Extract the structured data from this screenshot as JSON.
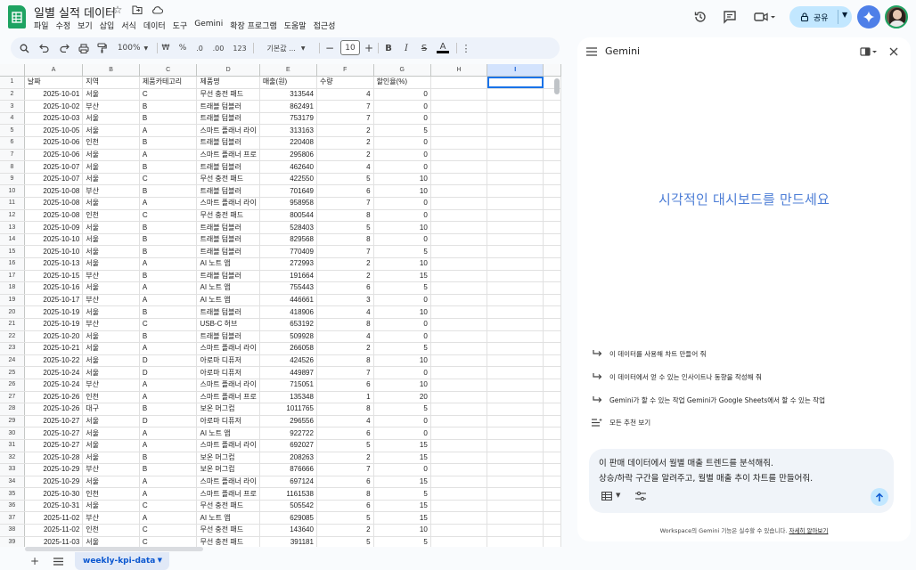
{
  "doc": {
    "title": "일별 실적 데이터"
  },
  "menu": [
    "파일",
    "수정",
    "보기",
    "삽입",
    "서식",
    "데이터",
    "도구",
    "Gemini",
    "확장 프로그램",
    "도움말",
    "접근성"
  ],
  "share": {
    "label": "공유"
  },
  "toolbar": {
    "zoom": "100%",
    "currency": "₩",
    "percent": "%",
    "dec_dec": ".0",
    "dec_inc": ".00",
    "num_fmt": "123",
    "font": "기본값 ...",
    "font_size": "10",
    "bold": "B",
    "italic": "I",
    "strike": "S",
    "text_color": "A"
  },
  "sheet": {
    "columns": [
      "A",
      "B",
      "C",
      "D",
      "E",
      "F",
      "G",
      "H",
      "I"
    ],
    "selected_column": "I",
    "headers": [
      "날짜",
      "지역",
      "제품카테고리",
      "제품명",
      "매출(원)",
      "수량",
      "할인율(%)"
    ],
    "rows": [
      [
        "2025-10-01",
        "서울",
        "C",
        "무선 충전 패드",
        "313544",
        "4",
        "0"
      ],
      [
        "2025-10-02",
        "부산",
        "B",
        "트래블 텀블러",
        "862491",
        "7",
        "0"
      ],
      [
        "2025-10-03",
        "서울",
        "B",
        "트래블 텀블러",
        "753179",
        "7",
        "0"
      ],
      [
        "2025-10-05",
        "서울",
        "A",
        "스마트 플래너 라이",
        "313163",
        "2",
        "5"
      ],
      [
        "2025-10-06",
        "인천",
        "B",
        "트래블 텀블러",
        "220408",
        "2",
        "0"
      ],
      [
        "2025-10-06",
        "서울",
        "A",
        "스마트 플래너 프로",
        "295806",
        "2",
        "0"
      ],
      [
        "2025-10-07",
        "서울",
        "B",
        "트래블 텀블러",
        "462640",
        "4",
        "0"
      ],
      [
        "2025-10-07",
        "서울",
        "C",
        "무선 충전 패드",
        "422550",
        "5",
        "10"
      ],
      [
        "2025-10-08",
        "부산",
        "B",
        "트래블 텀블러",
        "701649",
        "6",
        "10"
      ],
      [
        "2025-10-08",
        "서울",
        "A",
        "스마트 플래너 라이",
        "958958",
        "7",
        "0"
      ],
      [
        "2025-10-08",
        "인천",
        "C",
        "무선 충전 패드",
        "800544",
        "8",
        "0"
      ],
      [
        "2025-10-09",
        "서울",
        "B",
        "트래블 텀블러",
        "528403",
        "5",
        "10"
      ],
      [
        "2025-10-10",
        "서울",
        "B",
        "트래블 텀블러",
        "829568",
        "8",
        "0"
      ],
      [
        "2025-10-10",
        "서울",
        "B",
        "트래블 텀블러",
        "770409",
        "7",
        "5"
      ],
      [
        "2025-10-13",
        "서울",
        "A",
        "AI 노트 앱",
        "272993",
        "2",
        "10"
      ],
      [
        "2025-10-15",
        "부산",
        "B",
        "트래블 텀블러",
        "191664",
        "2",
        "15"
      ],
      [
        "2025-10-16",
        "서울",
        "A",
        "AI 노트 앱",
        "755443",
        "6",
        "5"
      ],
      [
        "2025-10-17",
        "부산",
        "A",
        "AI 노트 앱",
        "446661",
        "3",
        "0"
      ],
      [
        "2025-10-19",
        "서울",
        "B",
        "트래블 텀블러",
        "418906",
        "4",
        "10"
      ],
      [
        "2025-10-19",
        "부산",
        "C",
        "USB-C 허브",
        "653192",
        "8",
        "0"
      ],
      [
        "2025-10-20",
        "서울",
        "B",
        "트래블 텀블러",
        "509928",
        "4",
        "0"
      ],
      [
        "2025-10-21",
        "서울",
        "A",
        "스마트 플래너 라이",
        "266058",
        "2",
        "5"
      ],
      [
        "2025-10-22",
        "서울",
        "D",
        "아로마 디퓨저",
        "424526",
        "8",
        "10"
      ],
      [
        "2025-10-24",
        "서울",
        "D",
        "아로마 디퓨저",
        "449897",
        "7",
        "0"
      ],
      [
        "2025-10-24",
        "부산",
        "A",
        "스마트 플래너 라이",
        "715051",
        "6",
        "10"
      ],
      [
        "2025-10-26",
        "인천",
        "A",
        "스마트 플래너 프로",
        "135348",
        "1",
        "20"
      ],
      [
        "2025-10-26",
        "대구",
        "B",
        "보온 머그컵",
        "1011765",
        "8",
        "5"
      ],
      [
        "2025-10-27",
        "서울",
        "D",
        "아로마 디퓨저",
        "296556",
        "4",
        "0"
      ],
      [
        "2025-10-27",
        "서울",
        "A",
        "AI 노트 앱",
        "922722",
        "6",
        "0"
      ],
      [
        "2025-10-27",
        "서울",
        "A",
        "스마트 플래너 라이",
        "692027",
        "5",
        "15"
      ],
      [
        "2025-10-28",
        "서울",
        "B",
        "보온 머그컵",
        "208263",
        "2",
        "15"
      ],
      [
        "2025-10-29",
        "부산",
        "B",
        "보온 머그컵",
        "876666",
        "7",
        "0"
      ],
      [
        "2025-10-29",
        "서울",
        "A",
        "스마트 플래너 라이",
        "697124",
        "6",
        "15"
      ],
      [
        "2025-10-30",
        "인천",
        "A",
        "스마트 플래너 프로",
        "1161538",
        "8",
        "5"
      ],
      [
        "2025-10-31",
        "서울",
        "C",
        "무선 충전 패드",
        "505542",
        "6",
        "15"
      ],
      [
        "2025-11-02",
        "부산",
        "A",
        "AI 노트 앱",
        "629085",
        "5",
        "15"
      ],
      [
        "2025-11-02",
        "인천",
        "C",
        "무선 충전 패드",
        "143640",
        "2",
        "10"
      ],
      [
        "2025-11-03",
        "서울",
        "C",
        "무선 충전 패드",
        "391181",
        "5",
        "5"
      ]
    ],
    "tab_name": "weekly-kpi-data"
  },
  "gemini": {
    "title": "Gemini",
    "hero": "시각적인 대시보드를 만드세요",
    "suggestions": [
      "이 데이터를 사용해 차트 만들어 줘",
      "이 데이터에서 얻 수 있는 인사이트나 동향을 작성해 줘",
      "Gemini가 할 수 있는 작업 Gemini가 Google Sheets에서 할 수 있는 작업",
      "모든 추천 보기"
    ],
    "prompt_line1": "이 판매 데이터에서 월별 매출 트렌드를 분석해줘.",
    "prompt_line2": "상승/하락 구간을 알려주고, 월별 매출 추이 차트를 만들어줘.",
    "footer_text": "Workspace의 Gemini 기능은 실수할 수 있습니다.",
    "footer_link": "자세히 알아보기"
  }
}
